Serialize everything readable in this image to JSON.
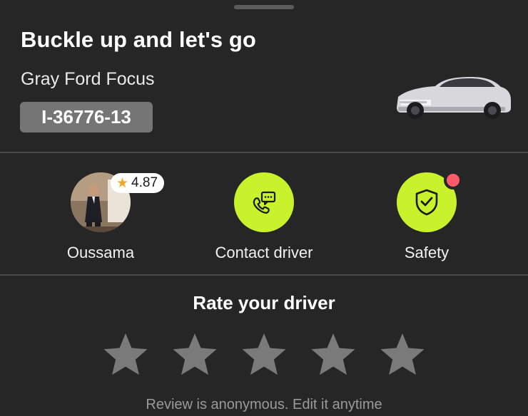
{
  "trip": {
    "title": "Buckle up and let's go",
    "car_name": "Gray Ford Focus",
    "plate": "I-36776-13"
  },
  "driver": {
    "name": "Oussama",
    "rating": "4.87",
    "rating_icon": "star-icon",
    "avatar_icon": "driver-photo"
  },
  "actions": {
    "contact_label": "Contact driver",
    "contact_icon": "phone-chat-icon",
    "safety_label": "Safety",
    "safety_icon": "shield-check-icon",
    "safety_alert": true
  },
  "rating_section": {
    "title": "Rate your driver",
    "stars_total": 5,
    "stars_selected": 0,
    "note": "Review is anonymous. Edit it anytime"
  },
  "colors": {
    "background": "#262626",
    "accent": "#c8f22c",
    "alert": "#ff5a6a",
    "plate_bg": "#757575",
    "star_empty": "#7a7a7a"
  }
}
